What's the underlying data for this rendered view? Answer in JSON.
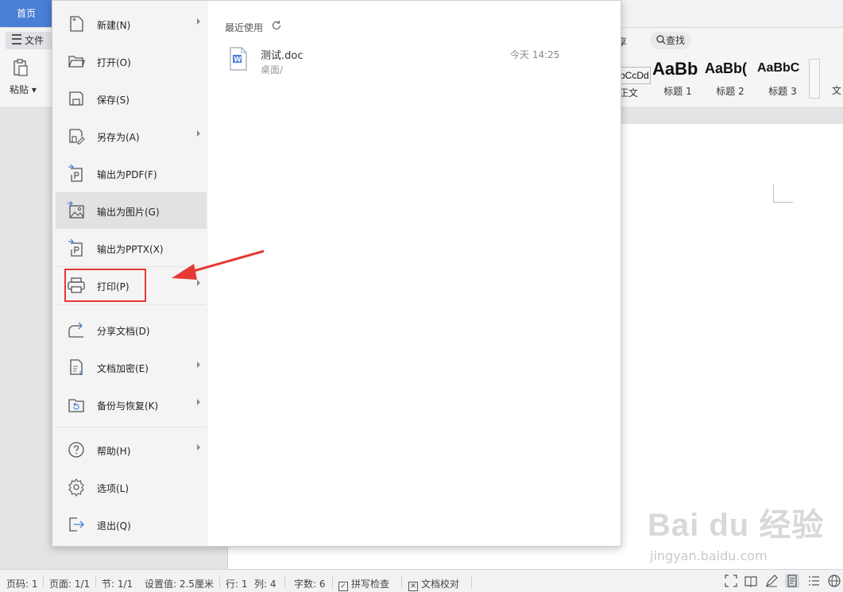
{
  "topbar": {
    "home_tab": "首页"
  },
  "ribbon": {
    "file_label": "文件",
    "paste_label": "粘贴",
    "share_label": "享",
    "find_label": "查找",
    "side_label": "文",
    "styles": [
      {
        "sample": "bCcDd",
        "name": "正文"
      },
      {
        "sample": "AaBb",
        "name": "标题 1"
      },
      {
        "sample": "AaBb(",
        "name": "标题 2"
      },
      {
        "sample": "AaBbC",
        "name": "标题 3"
      }
    ]
  },
  "file_menu": {
    "items": [
      {
        "label": "新建(N)",
        "icon": "new-doc-icon",
        "submenu": true
      },
      {
        "label": "打开(O)",
        "icon": "folder-open-icon",
        "submenu": false
      },
      {
        "label": "保存(S)",
        "icon": "save-icon",
        "submenu": false
      },
      {
        "label": "另存为(A)",
        "icon": "save-as-icon",
        "submenu": true
      },
      {
        "label": "输出为PDF(F)",
        "icon": "export-pdf-icon",
        "submenu": false
      },
      {
        "label": "输出为图片(G)",
        "icon": "export-image-icon",
        "submenu": false
      },
      {
        "label": "输出为PPTX(X)",
        "icon": "export-pptx-icon",
        "submenu": false
      },
      {
        "label": "打印(P)",
        "icon": "printer-icon",
        "submenu": true
      },
      {
        "label": "分享文档(D)",
        "icon": "share-icon",
        "submenu": false
      },
      {
        "label": "文档加密(E)",
        "icon": "encrypt-icon",
        "submenu": true
      },
      {
        "label": "备份与恢复(K)",
        "icon": "backup-icon",
        "submenu": true
      },
      {
        "label": "帮助(H)",
        "icon": "help-icon",
        "submenu": true
      },
      {
        "label": "选项(L)",
        "icon": "gear-icon",
        "submenu": false
      },
      {
        "label": "退出(Q)",
        "icon": "exit-icon",
        "submenu": false
      }
    ],
    "highlighted_item": "输出为图片(G)",
    "recent": {
      "title": "最近使用",
      "files": [
        {
          "name": "测试.doc",
          "path": "桌面/",
          "time": "今天 14:25"
        }
      ]
    }
  },
  "statusbar": {
    "page": "页码: 1",
    "pages": "页面: 1/1",
    "section": "节: 1/1",
    "setting": "设置值: 2.5厘米",
    "row": "行: 1",
    "col": "列: 4",
    "word_count": "字数: 6",
    "spell_check": "拼写检查",
    "doc_proof": "文档校对"
  },
  "watermark": {
    "main": "Bai du 经验",
    "sub": "jingyan.baidu.com"
  },
  "colors": {
    "accent": "#4a7fd6",
    "annotation": "#e53935"
  }
}
